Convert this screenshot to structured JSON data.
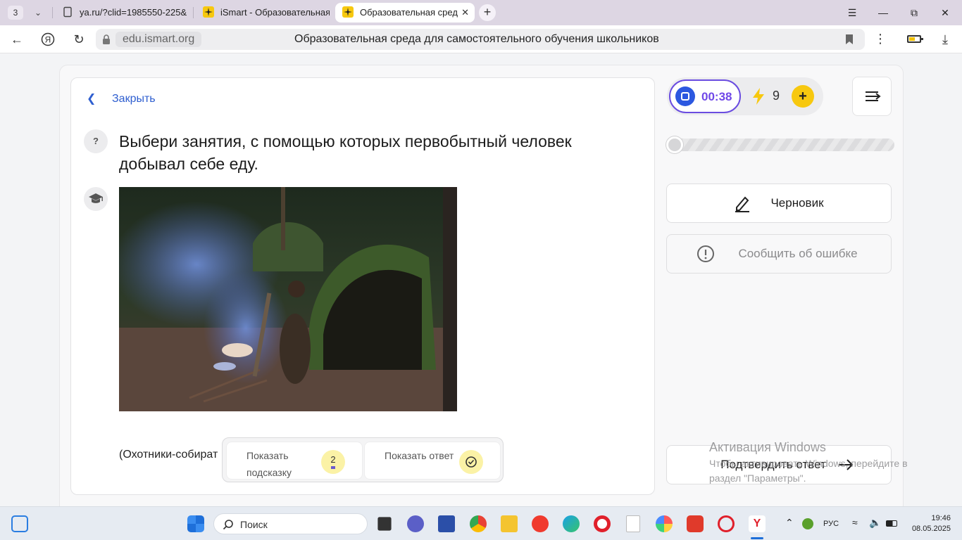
{
  "browser": {
    "tab_count": "3",
    "tabs": [
      {
        "label": "ya.ru/?clid=1985550-225&"
      },
      {
        "label": "iSmart - Образовательная"
      },
      {
        "label": "Образовательная сред"
      }
    ],
    "domain": "edu.ismart.org",
    "page_title": "Образовательная среда для самостоятельного обучения школьников"
  },
  "task": {
    "close_label": "Закрыть",
    "question_badge": "?",
    "question": "Выбери занятия, с помощью которых первобытный человек добывал себе еду.",
    "answer_text": "(Охотники-собират"
  },
  "hints": {
    "hint_label": "Показать подсказку",
    "hint_count": "2",
    "answer_label": "Показать ответ"
  },
  "status": {
    "timer": "00:38",
    "energy": "9",
    "plus": "+",
    "progress_fraction": 0
  },
  "sidebar": {
    "draft_label": "Черновик",
    "report_label": "Сообщить об ошибке",
    "submit_label": "Подтвердить ответ"
  },
  "watermark": {
    "title": "Активация Windows",
    "text": "Чтобы активировать Windows, перейдите в раздел \"Параметры\"."
  },
  "taskbar": {
    "search_placeholder": "Поиск",
    "language": "РУС",
    "time": "19:46",
    "date": "08.05.2025"
  },
  "colors": {
    "accent_blue": "#2f5fd0",
    "timer_purple": "#7048e8",
    "energy_yellow": "#f7c80f"
  }
}
